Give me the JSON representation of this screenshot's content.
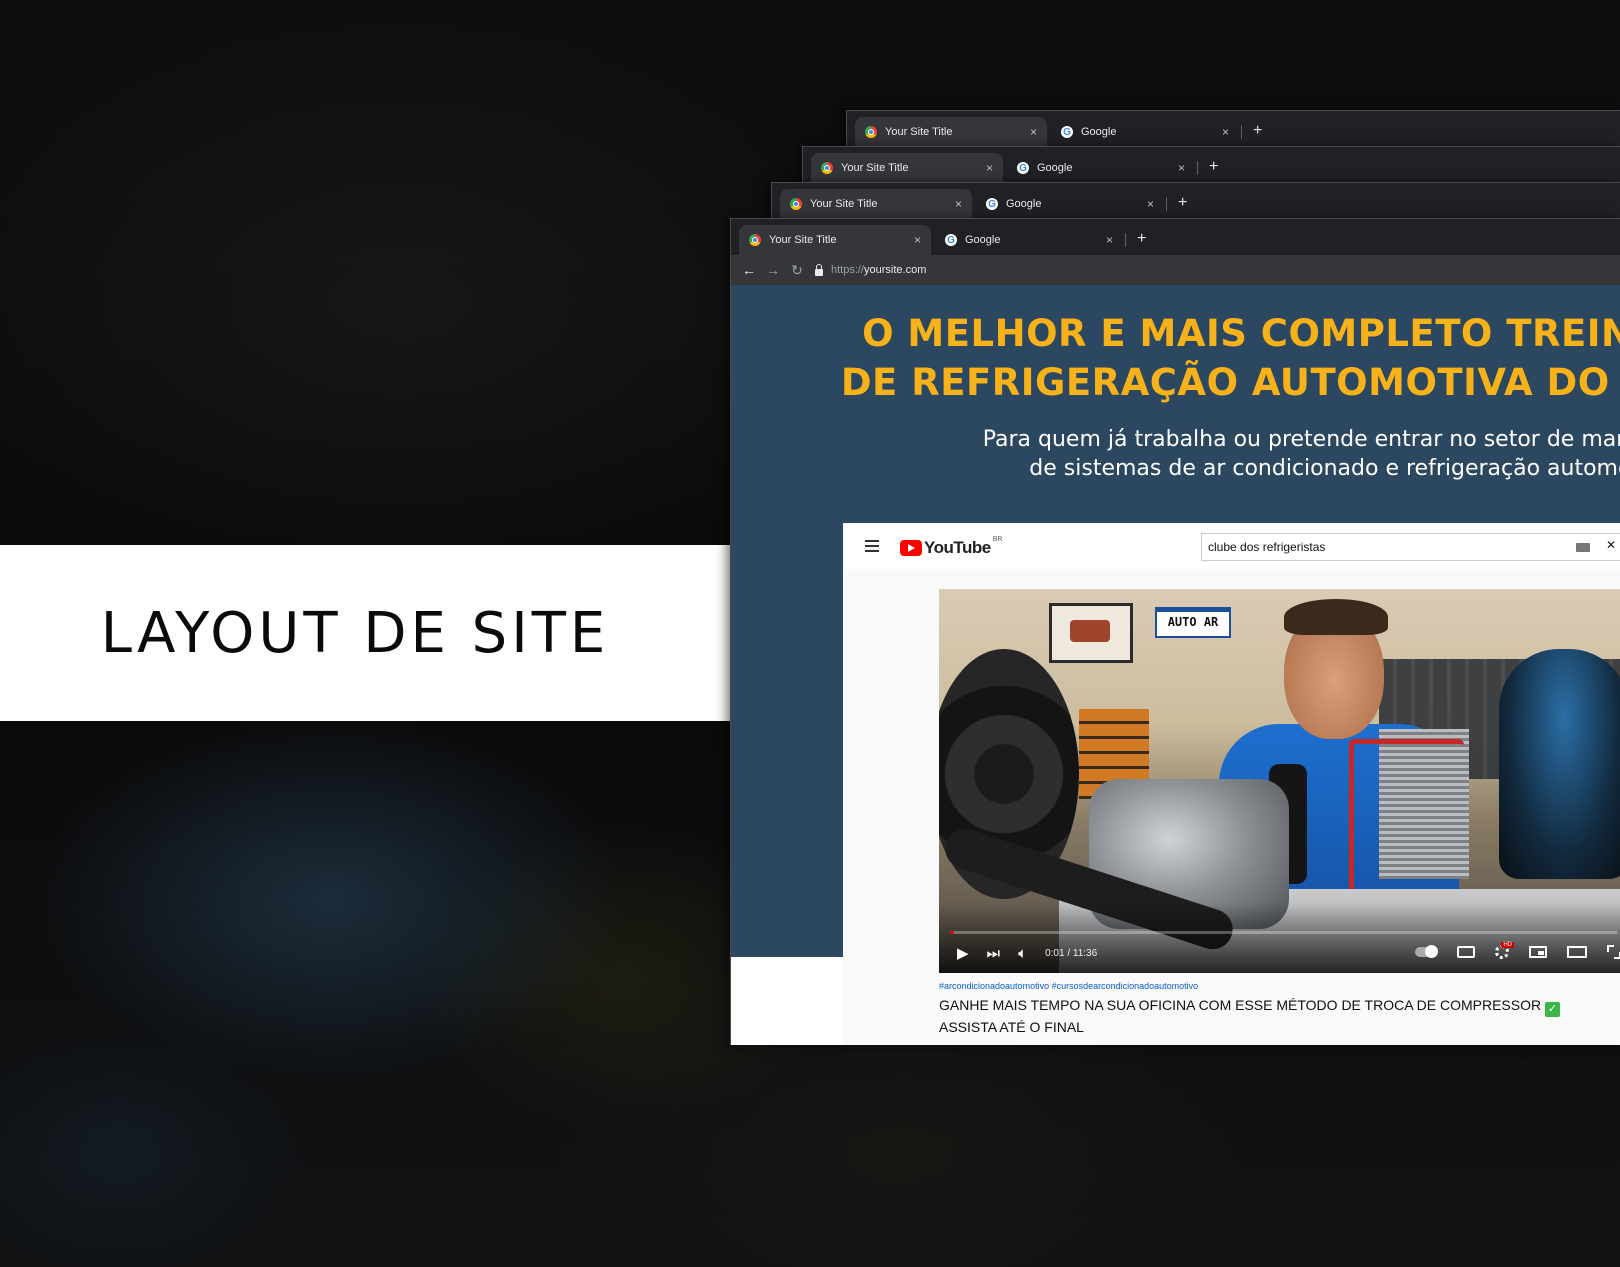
{
  "label": "LAYOUT DE SITE",
  "browser": {
    "tabs": [
      {
        "title": "Your Site Title",
        "icon": "chrome-icon"
      },
      {
        "title": "Google",
        "icon": "google-icon"
      }
    ],
    "new_tab": "+",
    "close": "×",
    "url_scheme": "https://",
    "url_host": "yoursite.com"
  },
  "site": {
    "headline_1": "O MELHOR E MAIS COMPLETO TREINAMENTO",
    "headline_2": "DE REFRIGERAÇÃO AUTOMOTIVA DO MERCADO",
    "subline_1": "Para quem já trabalha ou pretende entrar no setor de manutenção",
    "subline_2": "de sistemas de ar condicionado e refrigeração automotiva",
    "colors": {
      "background": "#2c4760",
      "accent": "#f7b21a"
    }
  },
  "youtube": {
    "logo_text": "YouTube",
    "region": "BR",
    "search_value": "clube dos refrigeristas",
    "video": {
      "plate_text": "AUTO AR",
      "time": "0:01 / 11:36",
      "progress": 0.002
    },
    "tags": "#arcondicionadoautomotivo #cursosdearcondicionadoautomotivo",
    "title_part1": "GANHE MAIS TEMPO NA SUA OFICINA COM ESSE MÉTODO DE TROCA DE COMPRESSOR",
    "title_part2": "ASSISTA ATÉ O FINAL",
    "hd_badge": "HD"
  }
}
